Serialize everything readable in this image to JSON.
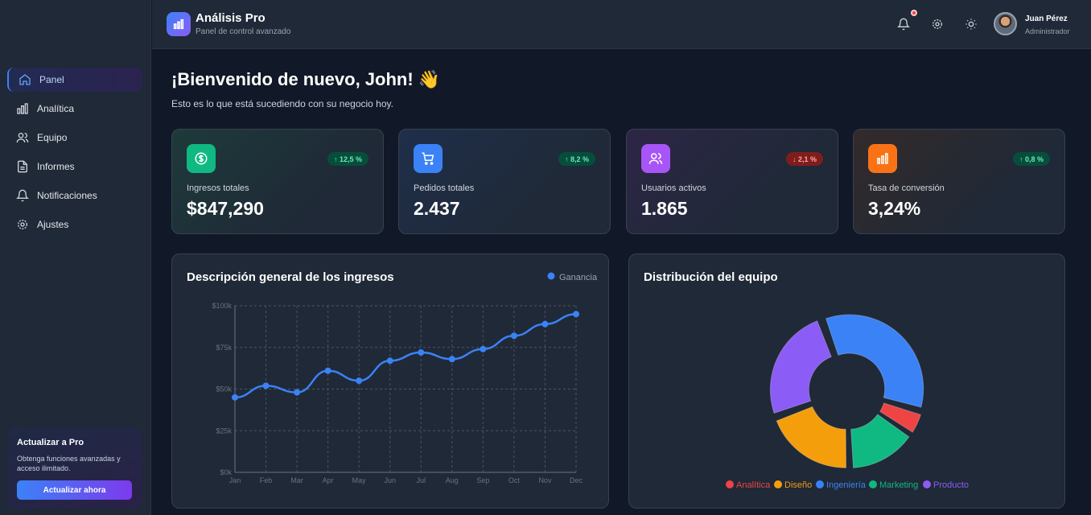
{
  "app": {
    "title": "Análisis Pro",
    "subtitle": "Panel de control avanzado"
  },
  "user": {
    "name": "Juan Pérez",
    "role": "Administrador"
  },
  "sidebar": {
    "items": [
      {
        "label": "Panel",
        "icon": "home-icon",
        "active": true
      },
      {
        "label": "Analítica",
        "icon": "bar-chart-icon"
      },
      {
        "label": "Equipo",
        "icon": "users-icon"
      },
      {
        "label": "Informes",
        "icon": "file-icon"
      },
      {
        "label": "Notificaciones",
        "icon": "bell-icon"
      },
      {
        "label": "Ajustes",
        "icon": "gear-icon"
      }
    ],
    "upgrade": {
      "title": "Actualizar a Pro",
      "text": "Obtenga funciones avanzadas y acceso ilimitado.",
      "button": "Actualizar ahora"
    }
  },
  "welcome": {
    "title": "¡Bienvenido de nuevo, John! 👋",
    "subtitle": "Esto es lo que está sucediendo con su negocio hoy."
  },
  "stats": [
    {
      "label": "Ingresos totales",
      "value": "$847,290",
      "change": "↑ 12,5 %",
      "trend": "up",
      "icon": "dollar-icon",
      "color": "#10b981"
    },
    {
      "label": "Pedidos totales",
      "value": "2.437",
      "change": "↑ 8,2 %",
      "trend": "up",
      "icon": "cart-icon",
      "color": "#3b82f6"
    },
    {
      "label": "Usuarios activos",
      "value": "1.865",
      "change": "↓ 2,1 %",
      "trend": "down",
      "icon": "users-icon",
      "color": "#a855f7"
    },
    {
      "label": "Tasa de conversión",
      "value": "3,24%",
      "change": "↑ 0,8 %",
      "trend": "up",
      "icon": "bar-chart-icon",
      "color": "#f97316"
    }
  ],
  "revenue": {
    "title": "Descripción general de los ingresos"
  },
  "team": {
    "title": "Distribución del equipo"
  },
  "chart_data": [
    {
      "type": "line",
      "title": "Descripción general de los ingresos",
      "categories": [
        "Jan",
        "Feb",
        "Mar",
        "Apr",
        "May",
        "Jun",
        "Jul",
        "Aug",
        "Sep",
        "Oct",
        "Nov",
        "Dec"
      ],
      "series": [
        {
          "name": "Ganancia",
          "values": [
            45000,
            52000,
            48000,
            61000,
            55000,
            67000,
            72000,
            68000,
            74000,
            82000,
            89000,
            95000
          ],
          "color": "#3b82f6"
        }
      ],
      "yticks": [
        "$0k",
        "$25k",
        "$50k",
        "$75k",
        "$100k"
      ],
      "ylim": [
        0,
        100000
      ],
      "grid": true,
      "legend": "top-right"
    },
    {
      "type": "pie",
      "title": "Distribución del equipo",
      "slices": [
        {
          "label": "Analítica",
          "value": 5,
          "color": "#ef4444"
        },
        {
          "label": "Diseño",
          "value": 20,
          "color": "#f59e0b"
        },
        {
          "label": "Ingeniería",
          "value": 35,
          "color": "#3b82f6"
        },
        {
          "label": "Marketing",
          "value": 15,
          "color": "#10b981"
        },
        {
          "label": "Producto",
          "value": 25,
          "color": "#8b5cf6"
        }
      ],
      "legend": "bottom"
    }
  ]
}
